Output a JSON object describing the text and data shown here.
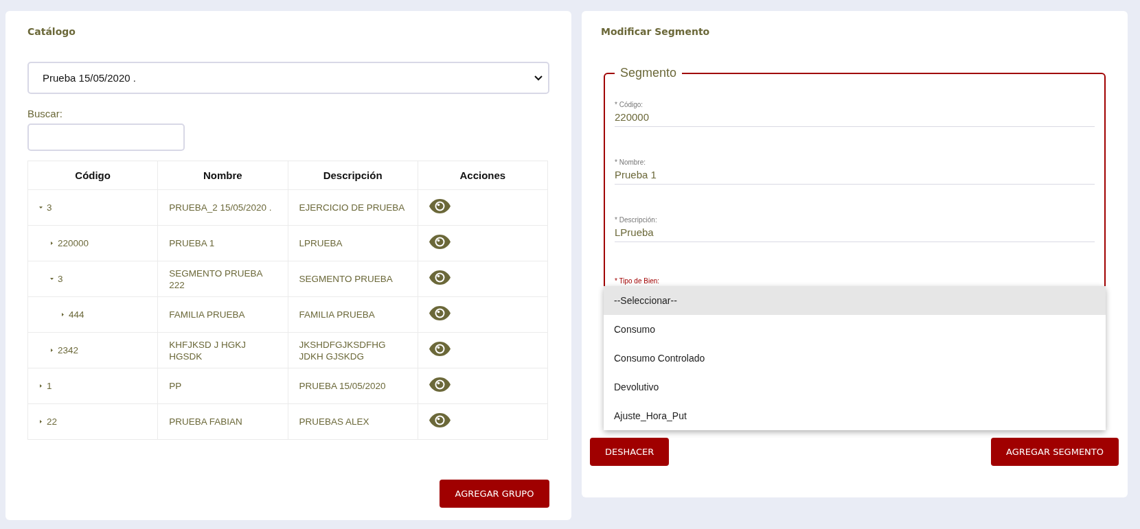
{
  "catalog": {
    "title": "Catálogo",
    "select_value": "Prueba 15/05/2020 .",
    "search_label": "Buscar:",
    "table": {
      "columns": [
        "Código",
        "Nombre",
        "Descripción",
        "Acciones"
      ],
      "rows": [
        {
          "code": "3",
          "name": "PRUEBA_2 15/05/2020 .",
          "description": "EJERCICIO DE PRUEBA",
          "expanded": true,
          "children": [
            {
              "code": "220000",
              "name": "PRUEBA 1",
              "description": "LPRUEBA",
              "expanded": false
            },
            {
              "code": "3",
              "name": "SEGMENTO PRUEBA 222",
              "description": "SEGMENTO PRUEBA",
              "expanded": true,
              "children": [
                {
                  "code": "444",
                  "name": "FAMILIA PRUEBA",
                  "description": "FAMILIA PRUEBA",
                  "expanded": false
                }
              ]
            },
            {
              "code": "2342",
              "name": "KHFJKSD J HGKJ HGSDK",
              "description": "JKSHDFGJKSDFHG JDKH GJSKDG",
              "expanded": false
            }
          ]
        },
        {
          "code": "1",
          "name": "PP",
          "description": "PRUEBA 15/05/2020",
          "expanded": false
        },
        {
          "code": "22",
          "name": "PRUEBA FABIAN",
          "description": "PRUEBAS ALEX",
          "expanded": false
        }
      ]
    },
    "add_button": "AGREGAR GRUPO"
  },
  "segment": {
    "title": "Modificar Segmento",
    "legend": "Segmento",
    "fields": [
      {
        "label": "* Código:",
        "value": "220000"
      },
      {
        "label": "* Nombre:",
        "value": "Prueba 1"
      },
      {
        "label": "* Descripción:",
        "value": "LPrueba"
      }
    ],
    "type_label": "* Tipo de Bien:",
    "dropdown_options": [
      {
        "label": "--Seleccionar--",
        "selected": true
      },
      {
        "label": "Consumo",
        "selected": false
      },
      {
        "label": "Consumo Controlado",
        "selected": false
      },
      {
        "label": "Devolutivo",
        "selected": false
      },
      {
        "label": "Ajuste_Hora_Put",
        "selected": false
      }
    ],
    "buttons": [
      "DESHACER",
      "AGREGAR SEGMENTO"
    ]
  }
}
